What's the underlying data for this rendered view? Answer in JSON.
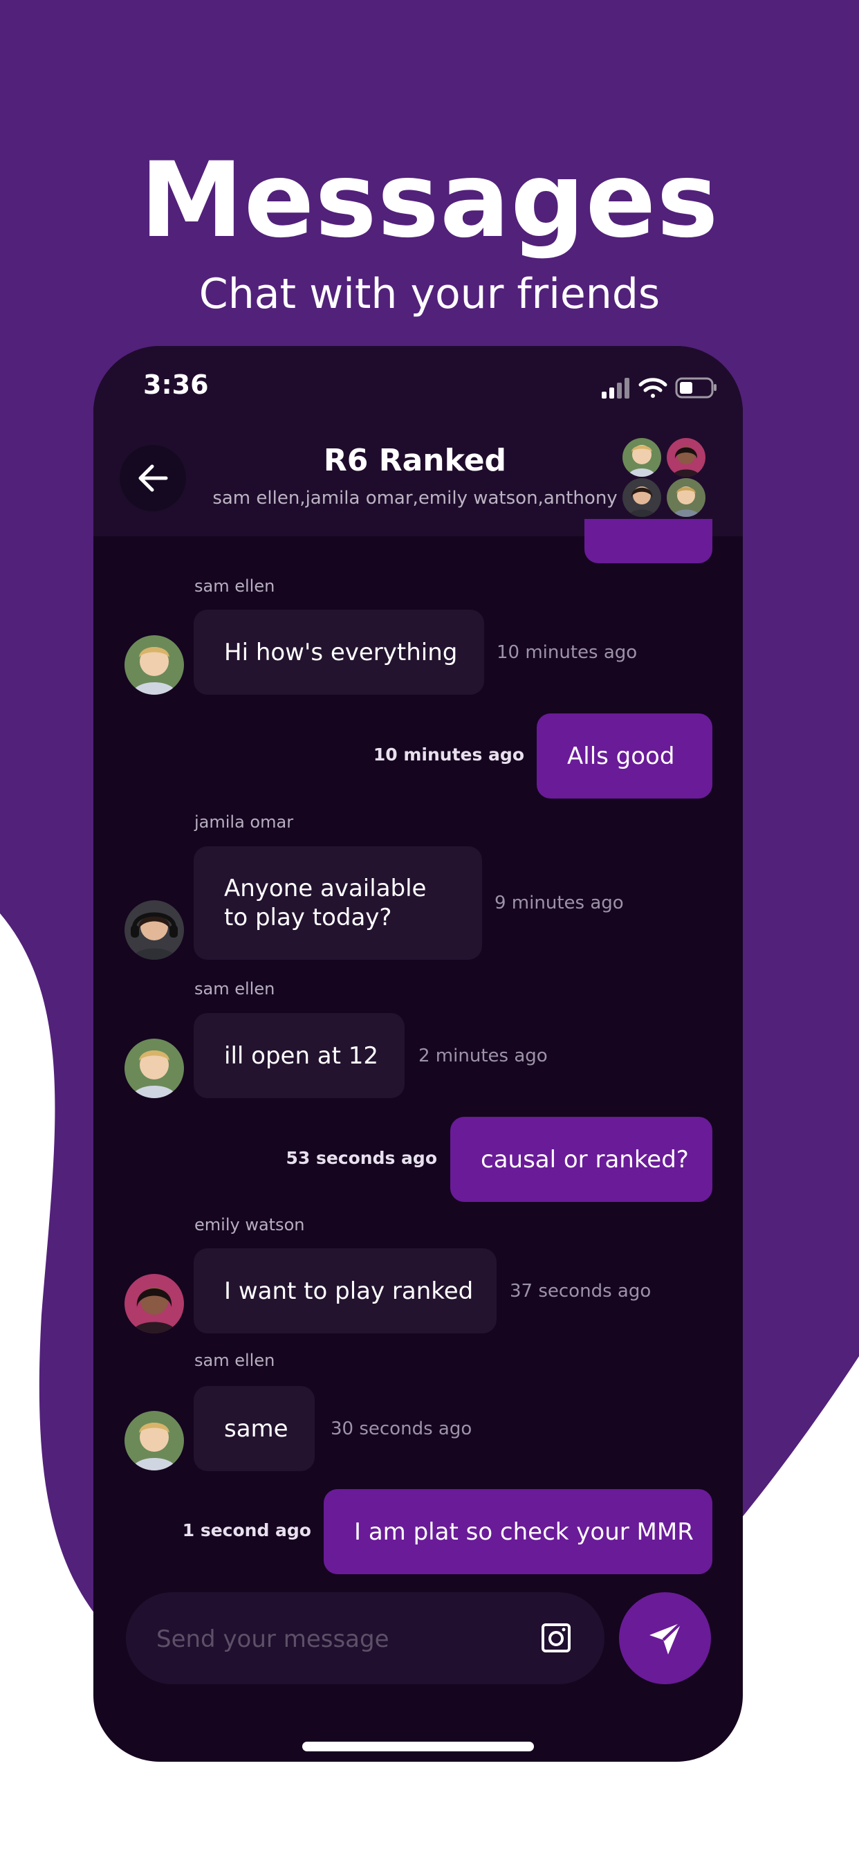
{
  "promo": {
    "headline": "Messages",
    "subline": "Chat with your friends"
  },
  "status_bar": {
    "time": "3:36",
    "icons": [
      "signal-icon",
      "wifi-icon",
      "battery-icon"
    ]
  },
  "chat_header": {
    "title": "R6 Ranked",
    "members_text": "sam ellen,jamila omar,emily watson,anthony",
    "back_icon": "arrow-left-icon",
    "member_avatars": [
      "sam ellen",
      "emily watson",
      "jamila omar",
      "anthony"
    ]
  },
  "messages": [
    {
      "sender": "sam ellen",
      "text": "Hi how's everything",
      "time": "10 minutes ago",
      "outgoing": false
    },
    {
      "sender": "",
      "text": "Alls good",
      "time": "10 minutes ago",
      "outgoing": true
    },
    {
      "sender": "jamila omar",
      "text": "Anyone available to play today?",
      "time": "9 minutes ago",
      "outgoing": false
    },
    {
      "sender": "sam ellen",
      "text": "ill open at 12",
      "time": "2 minutes ago",
      "outgoing": false
    },
    {
      "sender": "",
      "text": "causal or ranked?",
      "time": "53 seconds ago",
      "outgoing": true
    },
    {
      "sender": "emily watson",
      "text": "I want to play ranked",
      "time": "37 seconds ago",
      "outgoing": false
    },
    {
      "sender": "sam ellen",
      "text": "same",
      "time": "30 seconds ago",
      "outgoing": false
    },
    {
      "sender": "",
      "text": "I am plat so check your MMR",
      "time": "1 second ago",
      "outgoing": true
    }
  ],
  "composer": {
    "placeholder": "Send your message",
    "camera_icon": "camera-icon",
    "send_icon": "send-icon"
  },
  "colors": {
    "brand_purple": "#52217a",
    "outgoing_bubble": "#6a1b98",
    "incoming_bubble": "#23132f",
    "screen_bg": "#15051f"
  }
}
